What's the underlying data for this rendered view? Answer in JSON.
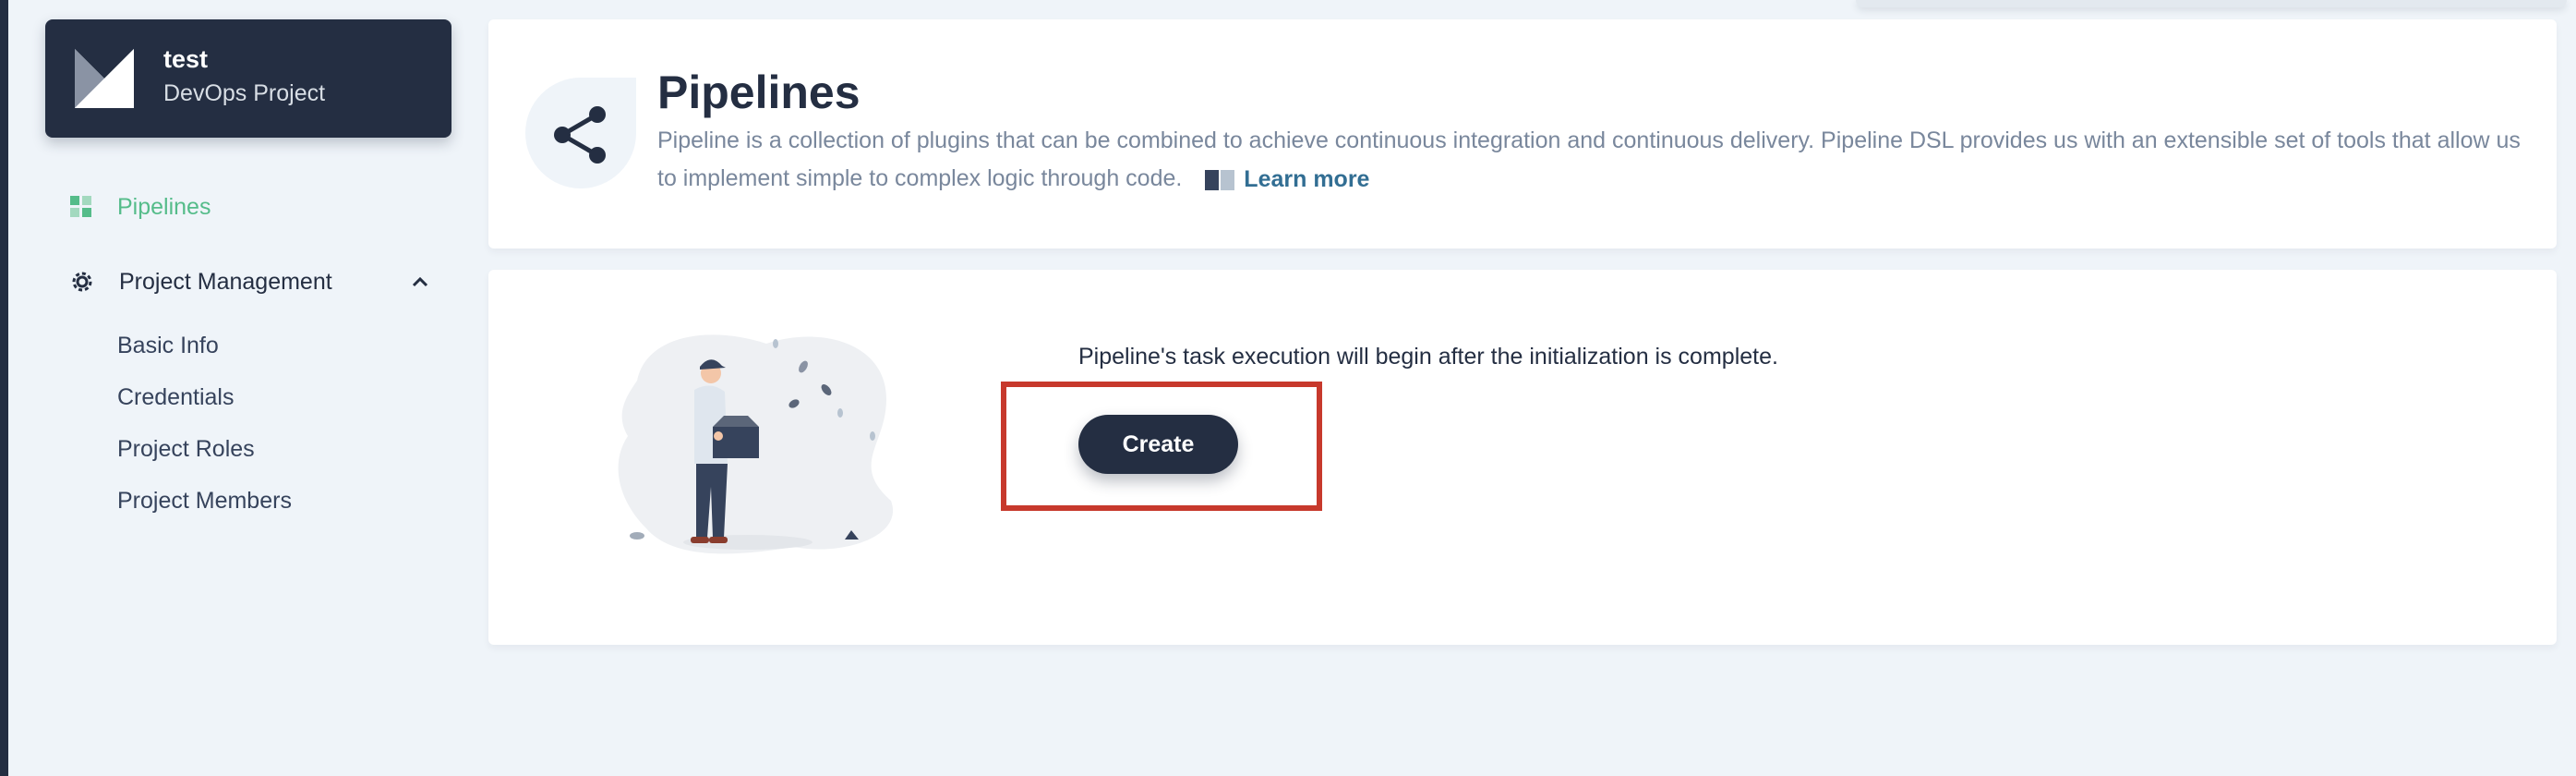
{
  "project": {
    "name": "test",
    "type": "DevOps Project"
  },
  "sidebar": {
    "items": [
      {
        "label": "Pipelines",
        "icon": "pipeline-grid-icon",
        "active": true
      },
      {
        "label": "Project Management",
        "icon": "gear-icon",
        "expanded": true,
        "children": [
          {
            "label": "Basic Info"
          },
          {
            "label": "Credentials"
          },
          {
            "label": "Project Roles"
          },
          {
            "label": "Project Members"
          }
        ]
      }
    ]
  },
  "banner": {
    "title": "Pipelines",
    "description": "Pipeline is a collection of plugins that can be combined to achieve continuous integration and continuous delivery. Pipeline DSL provides us with an extensible set of tools that allow us to implement simple to complex logic through code.",
    "learn_more": "Learn more",
    "icon": "share-nodes-icon"
  },
  "empty_state": {
    "message": "Pipeline's task execution will begin after the initialization is complete.",
    "create_label": "Create",
    "illustration": "person-holding-box-illustration"
  },
  "colors": {
    "sidebar_dark": "#242e42",
    "accent_green": "#55bc8a",
    "highlight_red": "#c7392c",
    "background": "#eff4f9"
  }
}
